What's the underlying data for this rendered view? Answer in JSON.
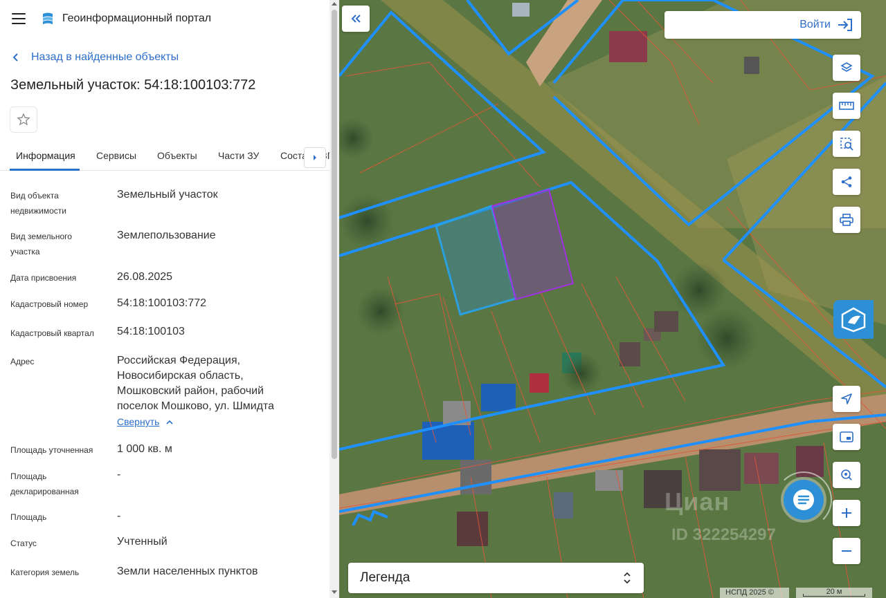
{
  "header": {
    "title": "Геоинформационный портал"
  },
  "nav": {
    "back_label": "Назад в найденные объекты"
  },
  "object": {
    "title": "Земельный участок: 54:18:100103:772"
  },
  "tabs": [
    "Информация",
    "Сервисы",
    "Объекты",
    "Части ЗУ",
    "Состав ЕЗП"
  ],
  "info": {
    "object_type_label": "Вид объекта недвижимости",
    "object_type_value": "Земельный участок",
    "land_type_label": "Вид земельного участка",
    "land_type_value": "Землепользование",
    "date_label": "Дата присвоения",
    "date_value": "26.08.2025",
    "cad_number_label": "Кадастровый номер",
    "cad_number_value": "54:18:100103:772",
    "cad_quarter_label": "Кадастровый квартал",
    "cad_quarter_value": "54:18:100103",
    "address_label": "Адрес",
    "address_line1": "Российская Федерация,",
    "address_line2": "Новосибирская область,",
    "address_line3": "Мошковский район, рабочий",
    "address_line4": "поселок Мошково, ул. Шмидта",
    "collapse_label": "Свернуть",
    "area_precise_label": "Площадь уточненная",
    "area_precise_value": "1 000 кв. м",
    "area_declared_label": "Площадь декларированная",
    "area_declared_value": "-",
    "area_label": "Площадь",
    "area_value": "-",
    "status_label": "Статус",
    "status_value": "Учтенный",
    "category_label": "Категория земель",
    "category_value": "Земли населенных пунктов"
  },
  "map": {
    "login_label": "Войти",
    "legend_label": "Легенда",
    "copyright": "НСПД 2025 ©",
    "scale": "20 м",
    "watermark": "Циан",
    "watermark_id": "ID 322254297"
  },
  "icons": {
    "menu": "hamburger-icon",
    "logo": "portal-logo-icon",
    "back": "chevron-left-icon",
    "favorite": "star-icon",
    "tabs_next": "caret-right-icon",
    "collapse_panel": "double-chevron-left-icon",
    "login": "login-icon",
    "layers": "layers-icon",
    "ruler": "ruler-icon",
    "select": "area-select-icon",
    "share": "share-icon",
    "print": "printer-icon",
    "brand": "map-brand-icon",
    "locate": "navigation-arrow-icon",
    "minimap": "minimap-icon",
    "geo": "geo-search-icon",
    "zoom_in": "plus-icon",
    "zoom_out": "minus-icon",
    "chat": "chat-icon",
    "legend_toggle": "sort-updown-icon"
  },
  "colors": {
    "accent": "#2d6ec9",
    "parcel_border": "#1e90ff",
    "selected_parcel": "#8a2be2",
    "cadastral_line": "#e0573a"
  }
}
